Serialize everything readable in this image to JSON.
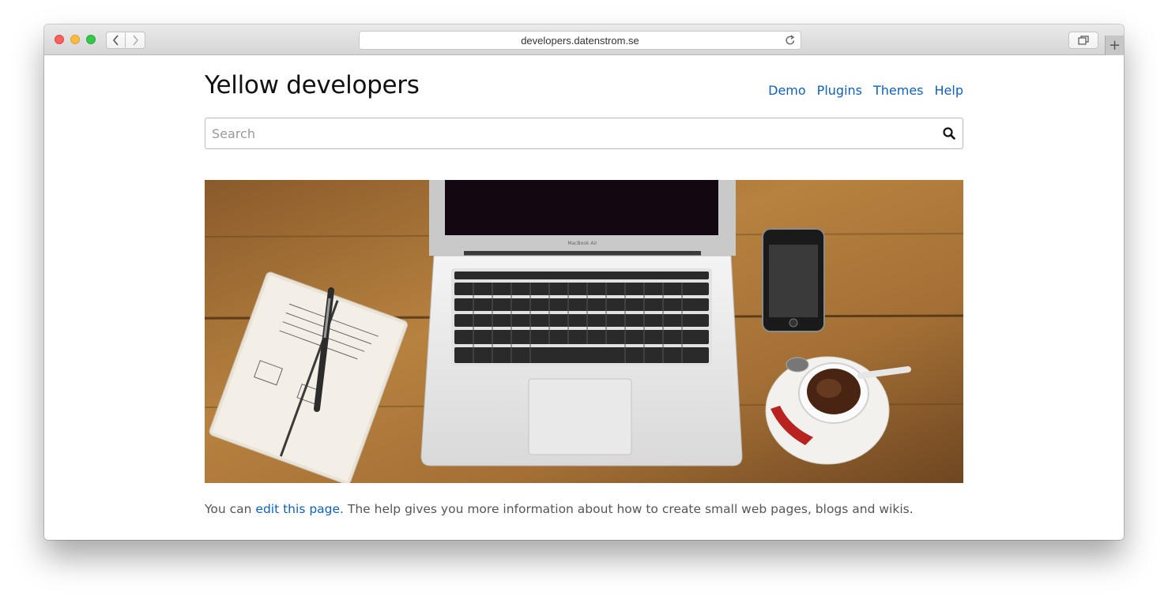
{
  "browser": {
    "url": "developers.datenstrom.se"
  },
  "site": {
    "title": "Yellow developers",
    "nav": [
      "Demo",
      "Plugins",
      "Themes",
      "Help"
    ],
    "search_placeholder": "Search"
  },
  "hero": {
    "laptop_brand": "MacBook Air"
  },
  "content": {
    "prefix": "You can ",
    "link": "edit this page",
    "suffix": ". The help gives you more information about how to create small web pages, blogs and wikis."
  },
  "colors": {
    "link": "#0f62b8",
    "title_text": "#111111",
    "body_text": "#555555"
  }
}
